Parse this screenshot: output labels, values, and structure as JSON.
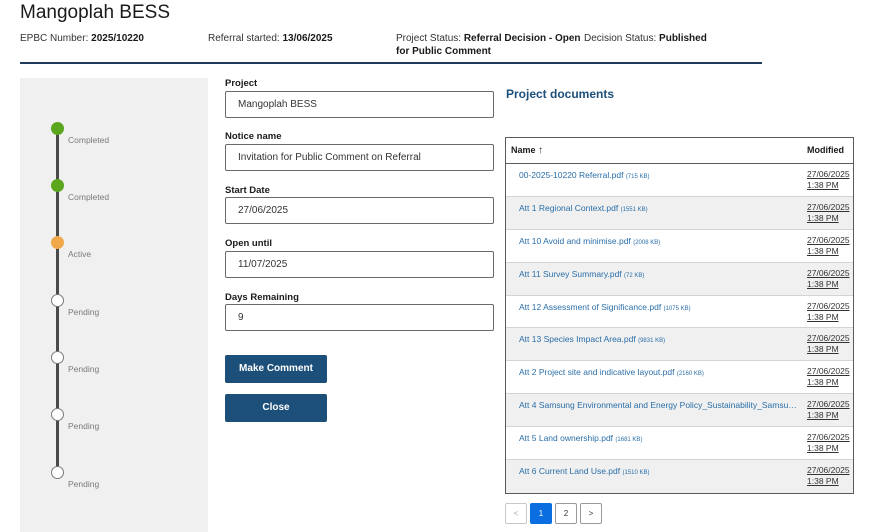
{
  "header": {
    "title": "Mangoplah BESS",
    "epbc_label": "EPBC Number:",
    "epbc_value": "2025/10220",
    "referral_label": "Referral started:",
    "referral_value": "13/06/2025",
    "project_status_label": "Project Status:",
    "project_status_value": "Referral Decision - Open",
    "project_status_value_2": "for Public Comment",
    "decision_status_label": "Decision Status:",
    "decision_status_value": "Published"
  },
  "stepper": {
    "steps": [
      {
        "status": "done",
        "label": "Completed"
      },
      {
        "status": "done",
        "label": "Completed"
      },
      {
        "status": "active",
        "label": "Active"
      },
      {
        "status": "pending",
        "label": "Pending"
      },
      {
        "status": "pending",
        "label": "Pending"
      },
      {
        "status": "pending",
        "label": "Pending"
      },
      {
        "status": "pending",
        "label": "Pending"
      }
    ]
  },
  "form": {
    "project_label": "Project",
    "project_value": "Mangoplah BESS",
    "notice_label": "Notice name",
    "notice_value": "Invitation for Public Comment on Referral",
    "start_label": "Start Date",
    "start_value": "27/06/2025",
    "open_label": "Open until",
    "open_value": "11/07/2025",
    "days_label": "Days Remaining",
    "days_value": "9",
    "make_comment_label": "Make Comment",
    "close_label": "Close"
  },
  "documents": {
    "title": "Project documents",
    "col_name": "Name",
    "col_modified": "Modified",
    "rows": [
      {
        "name": "00-2025-10220 Referral.pdf",
        "size": "(715 KB)",
        "date": "27/06/2025",
        "time": "1:38 PM"
      },
      {
        "name": "Att 1 Regional Context.pdf",
        "size": "(1551 KB)",
        "date": "27/06/2025",
        "time": "1:38 PM"
      },
      {
        "name": "Att 10 Avoid and minimise.pdf",
        "size": "(2008 KB)",
        "date": "27/06/2025",
        "time": "1:38 PM"
      },
      {
        "name": "Att 11 Survey Summary.pdf",
        "size": "(72 KB)",
        "date": "27/06/2025",
        "time": "1:38 PM"
      },
      {
        "name": "Att 12 Assessment of Significance.pdf",
        "size": "(1075 KB)",
        "date": "27/06/2025",
        "time": "1:38 PM"
      },
      {
        "name": "Att 13 Species Impact Area.pdf",
        "size": "(9831 KB)",
        "date": "27/06/2025",
        "time": "1:38 PM"
      },
      {
        "name": "Att 2 Project site and indicative layout.pdf",
        "size": "(2160 KB)",
        "date": "27/06/2025",
        "time": "1:38 PM"
      },
      {
        "name": "Att 4 Samsung Environmental and Energy Policy_Sustainability_Samsun…",
        "size": "",
        "date": "27/06/2025",
        "time": "1:38 PM"
      },
      {
        "name": "Att 5 Land ownership.pdf",
        "size": "(1681 KB)",
        "date": "27/06/2025",
        "time": "1:38 PM"
      },
      {
        "name": "Att 6 Current Land Use.pdf",
        "size": "(1510 KB)",
        "date": "27/06/2025",
        "time": "1:38 PM"
      }
    ]
  },
  "pagination": {
    "prev": "<",
    "pages": [
      "1",
      "2"
    ],
    "current": "1",
    "next": ">"
  }
}
